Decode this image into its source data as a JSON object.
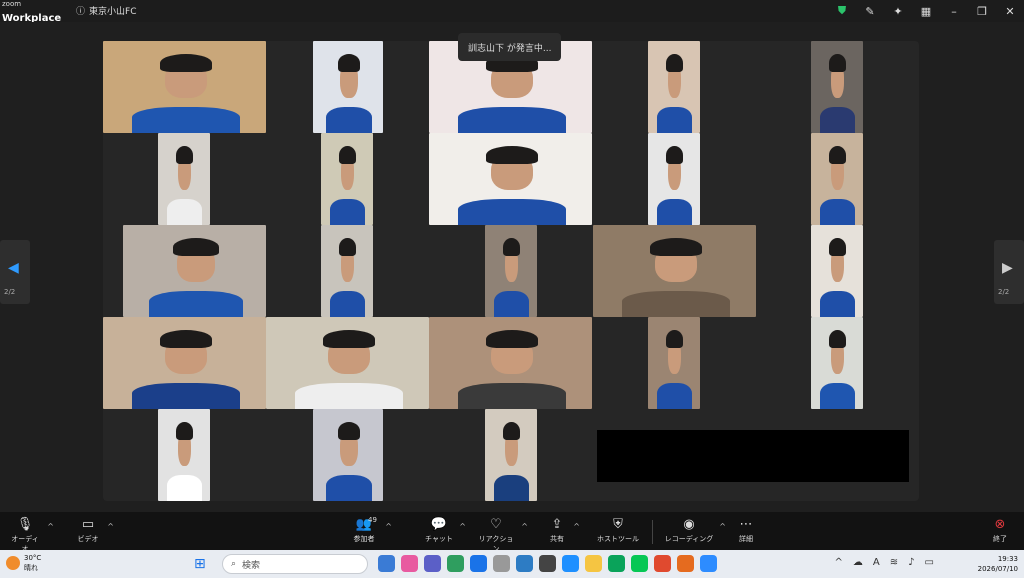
{
  "app": {
    "brand_small": "zoom",
    "brand_large": "Workplace",
    "meeting_title": "東京小山FC"
  },
  "titlebar_icons": [
    "shield-icon",
    "pen-icon",
    "pin-icon",
    "grid-icon",
    "minimize-icon",
    "restore-icon",
    "close-icon"
  ],
  "speaking_banner": "訓志山下 が発言中...",
  "pager": {
    "left_label": "2/2",
    "right_label": "2/2"
  },
  "tiles": [
    {
      "bg": "#c9a77a",
      "shirt": "#1f56b0"
    },
    {
      "bg": "#dfe3ea",
      "shirt": "#1f4fa8"
    },
    {
      "bg": "#efe6e6",
      "shirt": "#1f4fa8"
    },
    {
      "bg": "#d8c5b3",
      "shirt": "#1f4fa8"
    },
    {
      "bg": "#6b6560",
      "shirt": "#2a3a70"
    },
    {
      "bg": "#d6d2cc",
      "shirt": "#eeeeee"
    },
    {
      "bg": "#cfcab6",
      "shirt": "#1f4fa8"
    },
    {
      "bg": "#f1eeea",
      "shirt": "#1f4fa8"
    },
    {
      "bg": "#e6e6e6",
      "shirt": "#1f4fa8"
    },
    {
      "bg": "#c7b39c",
      "shirt": "#1f4fa8"
    },
    {
      "bg": "#b8afa6",
      "shirt": "#1f56b0"
    },
    {
      "bg": "#c8c4bc",
      "shirt": "#1f4fa8"
    },
    {
      "bg": "#8f8276",
      "shirt": "#1f4fa8"
    },
    {
      "bg": "#8f7b66",
      "shirt": "#6b5a4a"
    },
    {
      "bg": "#e6e1da",
      "shirt": "#1f4fa8"
    },
    {
      "bg": "#c7b199",
      "shirt": "#1b3f8a"
    },
    {
      "bg": "#cfc8b8",
      "shirt": "#eeeeee"
    },
    {
      "bg": "#ad917a",
      "shirt": "#3a3a3a"
    },
    {
      "bg": "#9b8572",
      "shirt": "#1f4fa8"
    },
    {
      "bg": "#d9dbd6",
      "shirt": "#1f56b0"
    },
    {
      "bg": "#e2e2e2",
      "shirt": "#ffffff"
    },
    {
      "bg": "#c6c7cf",
      "shirt": "#1f4fa8"
    },
    {
      "bg": "#d3cbbf",
      "shirt": "#1a3f7e"
    }
  ],
  "toolbar": {
    "audio": "オーディオ",
    "video": "ビデオ",
    "participants": "参加者",
    "participants_count": "49",
    "chat": "チャット",
    "reactions": "リアクション",
    "share": "共有",
    "host_tools": "ホストツール",
    "record": "レコーディング",
    "more": "詳細",
    "end": "終了"
  },
  "taskbar": {
    "temperature": "30°C",
    "weather": "晴れ",
    "search_placeholder": "検索",
    "time": "19:33",
    "date": "2026/07/10",
    "app_colors": [
      "#3a7bd5",
      "#e85aa0",
      "#5b5fc7",
      "#2f9e5f",
      "#1a73e8",
      "#999999",
      "#2d7cc4",
      "#444444",
      "#1e90ff",
      "#f5c542",
      "#0aa35a",
      "#06c755",
      "#e04a2f",
      "#e56b1f",
      "#2d8cff"
    ]
  }
}
